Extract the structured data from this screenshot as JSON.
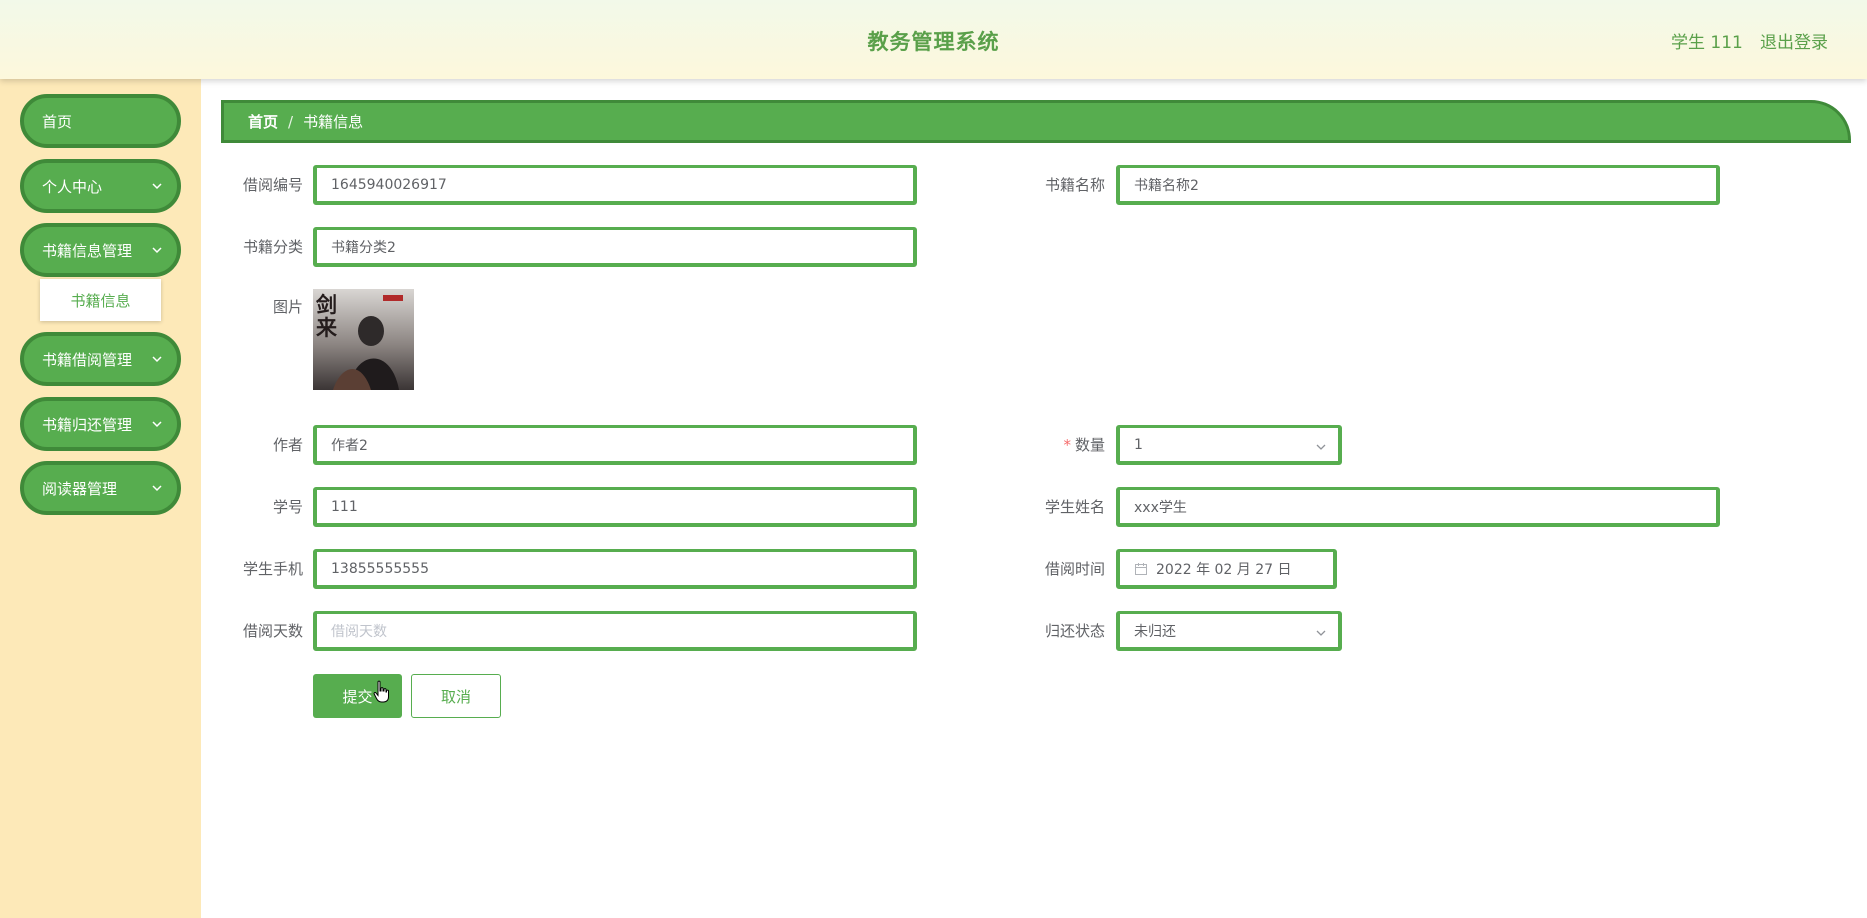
{
  "header": {
    "title": "教务管理系统",
    "user": "学生 111",
    "logout": "退出登录"
  },
  "sidebar": {
    "items": [
      {
        "label": "首页"
      },
      {
        "label": "个人中心"
      },
      {
        "label": "书籍信息管理"
      },
      {
        "label": "书籍借阅管理"
      },
      {
        "label": "书籍归还管理"
      },
      {
        "label": "阅读器管理"
      }
    ],
    "submenu": {
      "label": "书籍信息"
    }
  },
  "breadcrumb": {
    "home": "首页",
    "separator": "/",
    "current": "书籍信息"
  },
  "form": {
    "borrow_no": {
      "label": "借阅编号",
      "value": "1645940026917"
    },
    "book_name": {
      "label": "书籍名称",
      "value": "书籍名称2"
    },
    "category": {
      "label": "书籍分类",
      "value": "书籍分类2"
    },
    "image": {
      "label": "图片",
      "cover_text": "剑来"
    },
    "author": {
      "label": "作者",
      "value": "作者2"
    },
    "quantity": {
      "required_mark": "*",
      "label": "数量",
      "value": "1"
    },
    "student_no": {
      "label": "学号",
      "value": "111"
    },
    "student_name": {
      "label": "学生姓名",
      "value": "xxx学生"
    },
    "phone": {
      "label": "学生手机",
      "value": "13855555555"
    },
    "borrow_time": {
      "label": "借阅时间",
      "value": "2022 年 02 月 27 日"
    },
    "borrow_days": {
      "label": "借阅天数",
      "placeholder": "借阅天数"
    },
    "return_status": {
      "label": "归还状态",
      "value": "未归还"
    },
    "submit": "提交",
    "cancel": "取消"
  },
  "colors": {
    "accent": "#57ad4f",
    "accent_dark": "#3f8a39",
    "sidebar_bg": "#fde9b8",
    "required": "#f56c6c"
  }
}
